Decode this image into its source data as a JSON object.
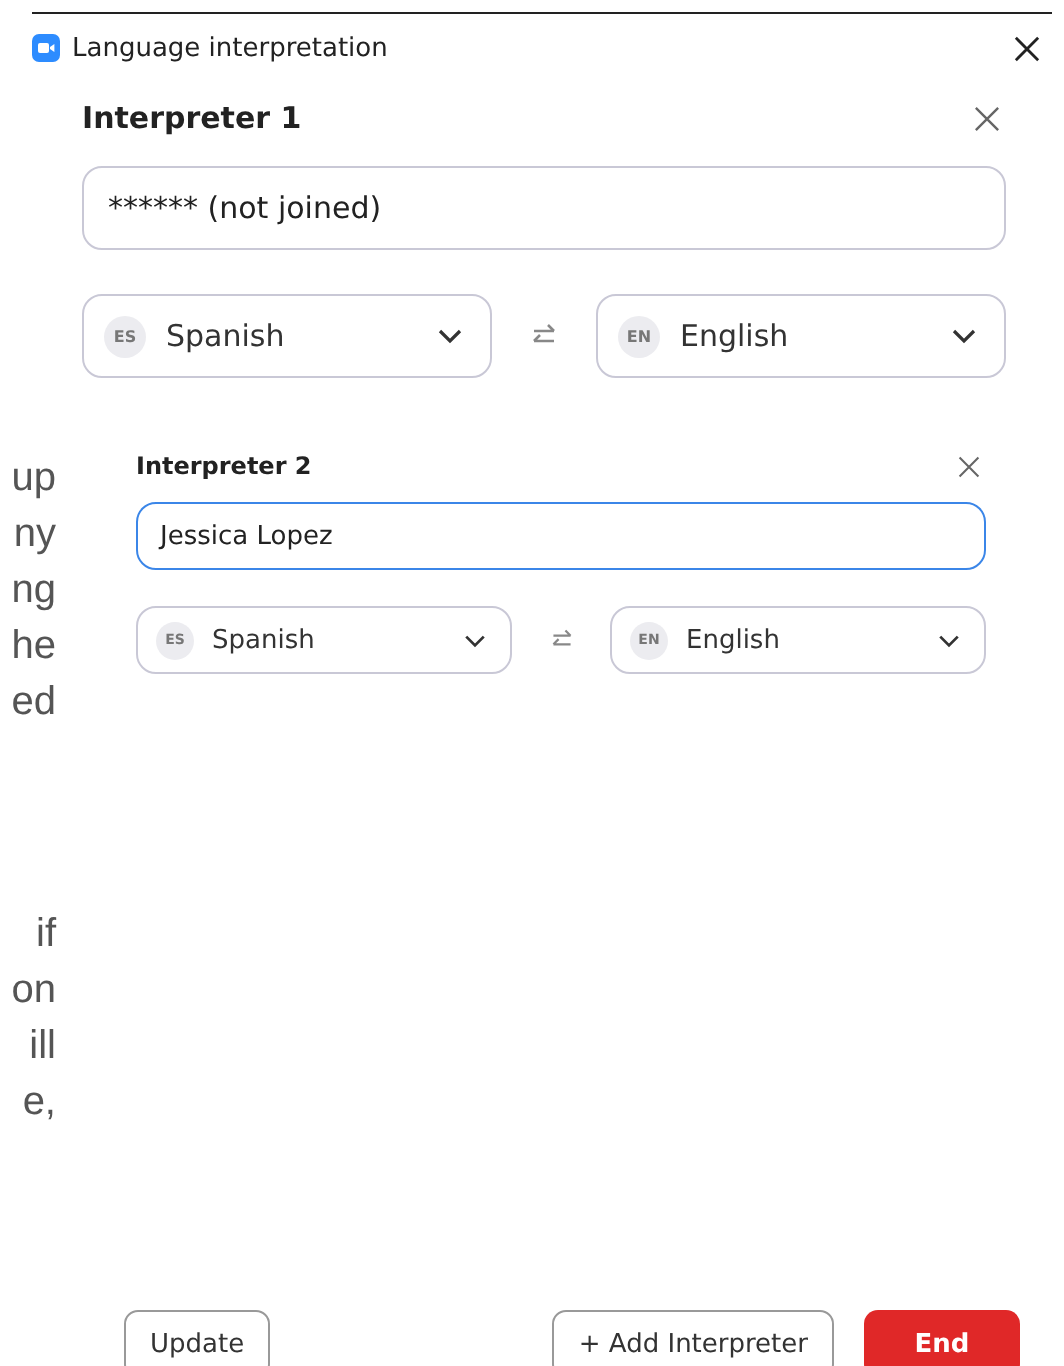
{
  "window": {
    "title": "Language interpretation"
  },
  "interpreters": [
    {
      "kind": "enlarged",
      "title": "Interpreter 1",
      "name": "****** (not joined)",
      "focused": false,
      "from": {
        "code": "ES",
        "language": "Spanish"
      },
      "to": {
        "code": "EN",
        "language": "English"
      }
    },
    {
      "kind": "normal",
      "title": "Interpreter 2",
      "name": "Jessica Lopez",
      "focused": true,
      "from": {
        "code": "ES",
        "language": "Spanish"
      },
      "to": {
        "code": "EN",
        "language": "English"
      }
    }
  ],
  "background_text": [
    {
      "lines": [
        "up",
        "ny",
        "ng",
        "he",
        "ed"
      ]
    },
    {
      "lines": [
        "if",
        "on",
        "ill",
        "e,"
      ]
    }
  ],
  "buttons": [
    {
      "label": "Update",
      "kind": "secondary"
    },
    {
      "label": "+ Add Interpreter",
      "kind": "secondary"
    },
    {
      "label": "End",
      "kind": "danger"
    }
  ]
}
